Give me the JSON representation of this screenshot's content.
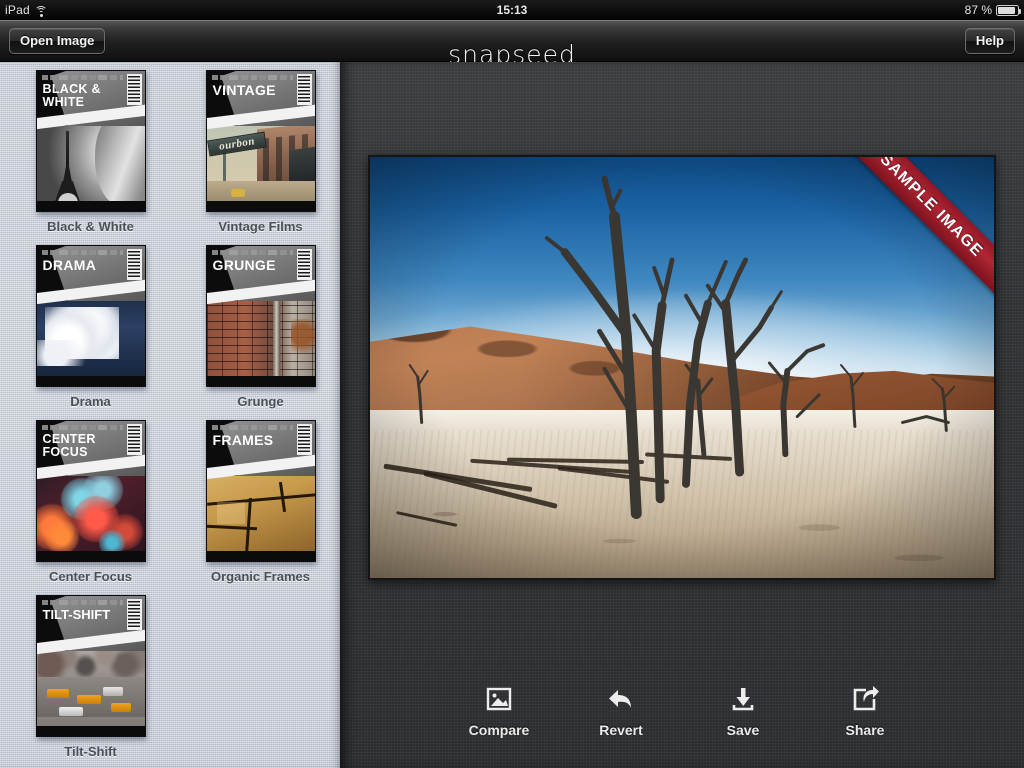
{
  "status_bar": {
    "carrier": "iPad",
    "wifi_icon": "wifi-icon",
    "time": "15:13",
    "battery_percent": "87 %",
    "battery_icon": "battery-icon"
  },
  "nav_bar": {
    "open_image_label": "Open Image",
    "app_title": "snapseed",
    "help_label": "Help"
  },
  "sidebar": {
    "filters": [
      {
        "label": "Black & White",
        "cover_title": "BLACK &\nWHITE",
        "masthead": "magazine-masthead-text",
        "barcode": "barcode-icon"
      },
      {
        "label": "Vintage Films",
        "cover_title": "VINTAGE",
        "sign_text": "ourbon",
        "masthead": "magazine-masthead-text",
        "barcode": "barcode-icon"
      },
      {
        "label": "Drama",
        "cover_title": "DRAMA",
        "masthead": "magazine-masthead-text",
        "barcode": "barcode-icon"
      },
      {
        "label": "Grunge",
        "cover_title": "GRUNGE",
        "masthead": "magazine-masthead-text",
        "barcode": "barcode-icon"
      },
      {
        "label": "Center Focus",
        "cover_title": "CENTER\nFOCUS",
        "masthead": "magazine-masthead-text",
        "barcode": "barcode-icon"
      },
      {
        "label": "Organic Frames",
        "cover_title": "FRAMES",
        "masthead": "magazine-masthead-text",
        "barcode": "barcode-icon"
      },
      {
        "label": "Tilt-Shift",
        "cover_title": "TILT-SHIFT",
        "masthead": "magazine-masthead-text",
        "barcode": "barcode-icon"
      }
    ]
  },
  "canvas": {
    "ribbon_text": "SAMPLE IMAGE",
    "photo_description": "dead-trees-desert-photo"
  },
  "toolbar": {
    "items": [
      {
        "label": "Compare",
        "icon": "image-icon"
      },
      {
        "label": "Revert",
        "icon": "undo-arrow-icon"
      },
      {
        "label": "Save",
        "icon": "download-icon"
      },
      {
        "label": "Share",
        "icon": "share-icon"
      }
    ]
  },
  "colors": {
    "ribbon_red": "#b02634",
    "sidebar_bg": "#cdd2db",
    "main_bg": "#303235",
    "nav_bg": "#1f1f1f"
  }
}
